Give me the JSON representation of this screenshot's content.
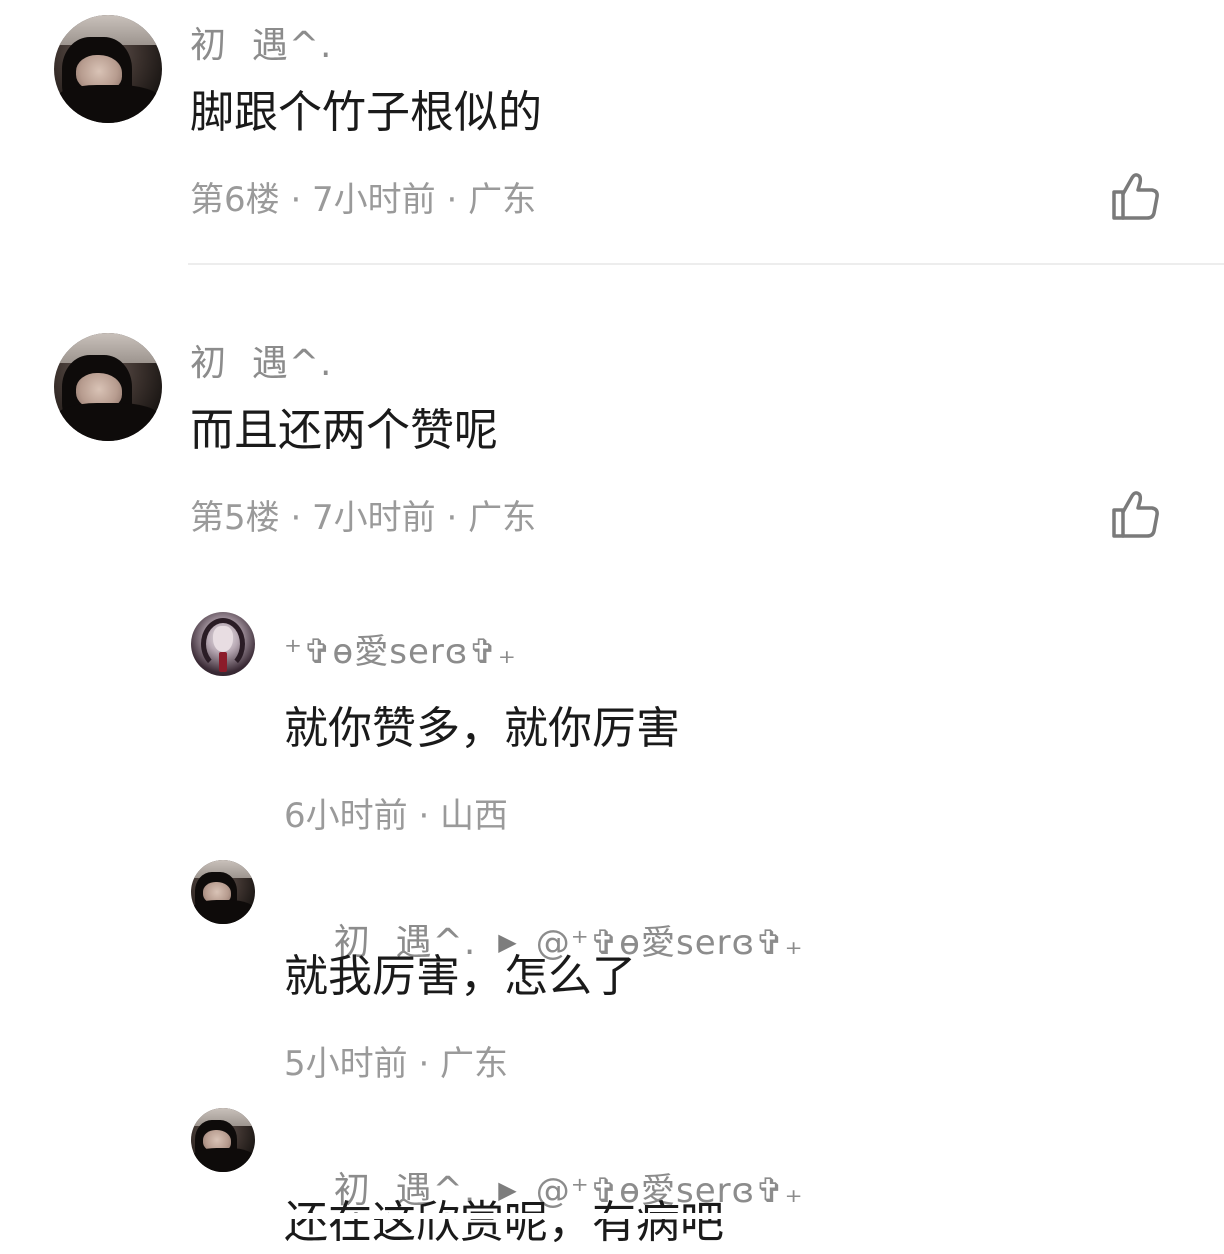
{
  "comments": [
    {
      "username": "初  遇^.",
      "content": "脚跟个竹子根似的",
      "meta": "第6楼 · 7小时前 · 广东",
      "like_icon": "thumbs-up-icon"
    },
    {
      "username": "初  遇^.",
      "content": "而且还两个赞呢",
      "meta": "第5楼 · 7小时前 · 广东",
      "like_icon": "thumbs-up-icon"
    }
  ],
  "replies": [
    {
      "username": "⁺✞ɵ愛serɞ✞₊",
      "content": "就你赞多，就你厉害",
      "meta": "6小时前 · 山西"
    },
    {
      "username": "初  遇^.",
      "reply_to": "@⁺✞ɵ愛serɞ✞₊",
      "content": "就我厉害，怎么了",
      "meta": "5小时前 · 广东"
    },
    {
      "username": "初  遇^.",
      "reply_to": "@⁺✞ɵ愛serɞ✞₊",
      "content": "还在这欣赏呢，有病吧"
    }
  ],
  "icons": {
    "reply_arrow": "▶"
  }
}
